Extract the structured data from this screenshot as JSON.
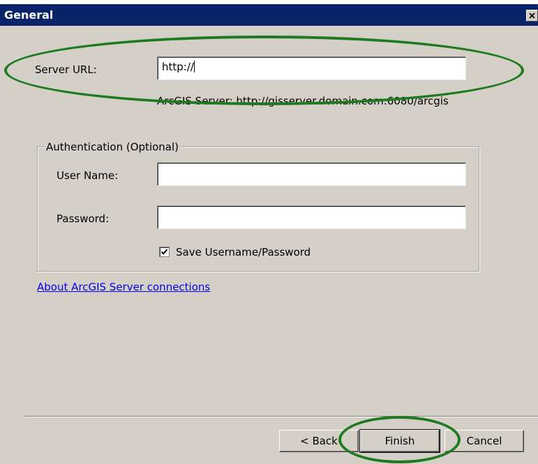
{
  "window": {
    "title": "General",
    "close_icon": "close-icon"
  },
  "server": {
    "label": "Server URL:",
    "value": "http://",
    "hint": "ArcGIS Server: http://gisserver.domain.com:6080/arcgis"
  },
  "authentication": {
    "legend": "Authentication (Optional)",
    "username_label": "User Name:",
    "username_value": "",
    "password_label": "Password:",
    "password_value": "",
    "save_label": "Save Username/Password",
    "save_checked": true
  },
  "link": {
    "about_text": "About ArcGIS Server connections"
  },
  "buttons": {
    "back": "< Back",
    "finish": "Finish",
    "cancel": "Cancel"
  },
  "colors": {
    "title_bar": "#0a246a",
    "dialog_bg": "#d4d0c8",
    "annotation": "#1e7a1e",
    "link": "#0000ee"
  }
}
